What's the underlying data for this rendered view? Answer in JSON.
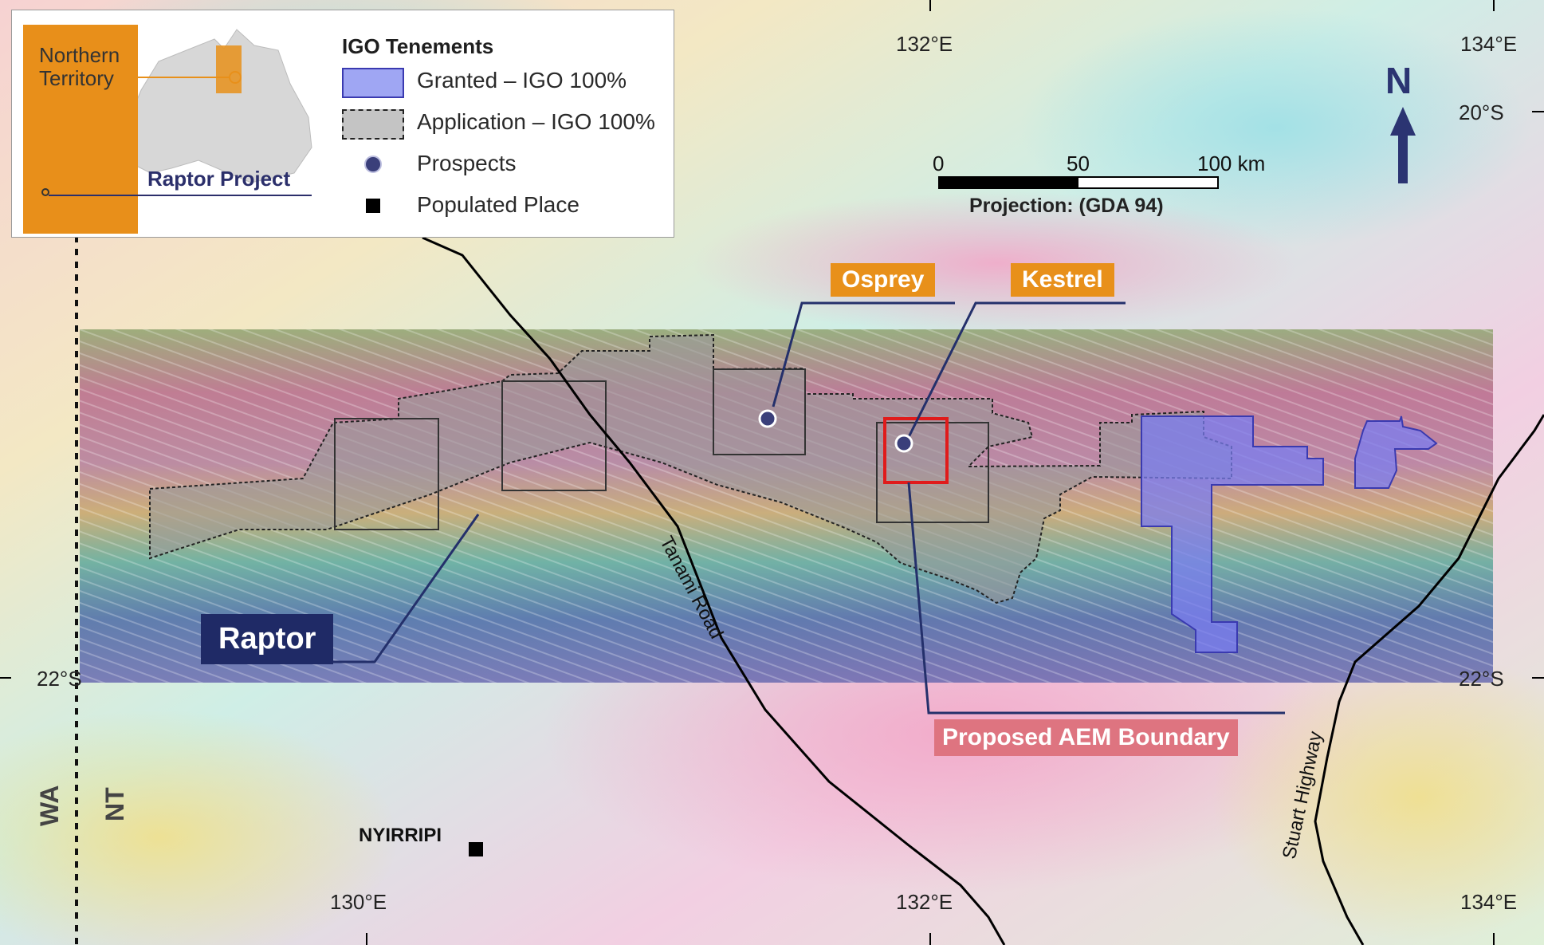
{
  "legend": {
    "title": "IGO Tenements",
    "items": [
      {
        "label": "Granted – IGO 100%",
        "symbol": "granted-swatch"
      },
      {
        "label": "Application – IGO 100%",
        "symbol": "application-swatch"
      },
      {
        "label": "Prospects",
        "symbol": "prospect-dot"
      },
      {
        "label": "Populated Place",
        "symbol": "populated-square"
      }
    ],
    "inset": {
      "region": "Northern Territory",
      "project": "Raptor Project"
    }
  },
  "graticule": {
    "top": [
      "132°E",
      "134°E"
    ],
    "bottom": [
      "130°E",
      "132°E",
      "134°E"
    ],
    "right": [
      "20°S",
      "22°S"
    ],
    "left": [
      "22°S"
    ]
  },
  "scale_bar": {
    "ticks": [
      "0",
      "50",
      "100 km"
    ],
    "projection": "Projection: (GDA 94)"
  },
  "north_arrow": "N",
  "prospects": [
    "Osprey",
    "Kestrel"
  ],
  "project_label": "Raptor",
  "aem_label": "Proposed AEM Boundary",
  "roads": [
    "Tanami Road",
    "Stuart Highway"
  ],
  "states": [
    "WA",
    "NT"
  ],
  "town": "NYIRRIPI",
  "colors": {
    "callout": "#e8901a",
    "raptor": "#1f2a66",
    "aem": "#de7480",
    "granted": "#7a7cf0",
    "box": "#e01b1b"
  }
}
